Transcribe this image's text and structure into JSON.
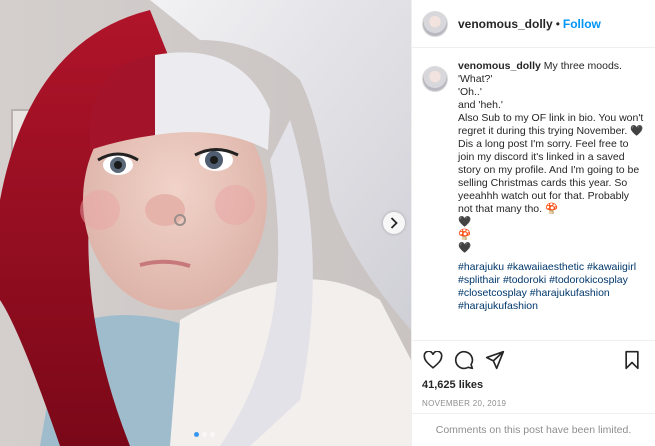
{
  "post": {
    "username": "venomous_dolly",
    "bullet": "•",
    "follow_label": "Follow",
    "caption_lines": [
      "My three moods.",
      "'What?'",
      "'Oh..'",
      "and 'heh.'",
      "Also Sub to my OF link in bio. You won't regret it during this trying November. 🖤",
      "Dis a long post I'm sorry. Feel free to join my discord it's linked in a saved story on my profile. And I'm going to be selling Christmas cards this year. So yeeahhh watch out for that. Probably not that many tho. 🍄",
      "🖤",
      "🍄",
      "🖤"
    ],
    "hashtags": [
      "#harajuku",
      "#kawaiiaesthetic",
      "#kawaiigirl",
      "#splithair",
      "#todoroki",
      "#todorokicosplay",
      "#closetcosplay",
      "#harajukufashion",
      "#harajukufashion"
    ],
    "likes": "41,625 likes",
    "date": "NOVEMBER 20, 2019",
    "comments_limited": "Comments on this post have been limited."
  },
  "carousel": {
    "count": 3,
    "active": 0
  },
  "icons": {
    "like": "heart-outline-icon",
    "comment": "speech-bubble-icon",
    "share": "paper-plane-icon",
    "save": "bookmark-icon",
    "next": "chevron-right-icon"
  },
  "colors": {
    "follow": "#0095f6",
    "hashtag": "#00376b",
    "muted": "#8e8e8e",
    "carousel_active": "#3897f0"
  }
}
